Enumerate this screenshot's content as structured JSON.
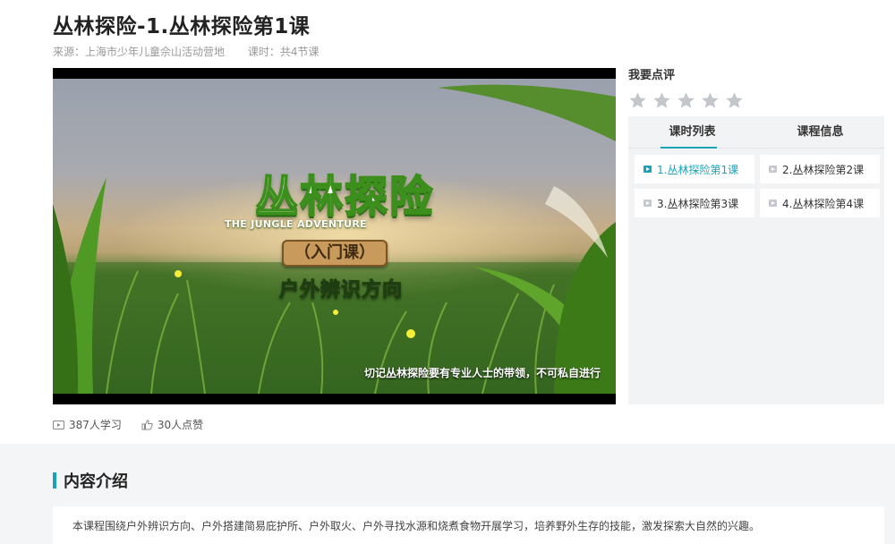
{
  "course": {
    "title": "丛林探险-1.丛林探险第1课",
    "source": "来源：上海市少年儿童佘山活动营地",
    "lessons_count": "课时：共4节课"
  },
  "video": {
    "logo_title": "丛林探险",
    "logo_en": "THE JUNGLE ADVENTURE",
    "plank": "（入门课）",
    "subtitle": "户外辨识方向",
    "caption": "切记丛林探险要有专业人士的带领，不可私自进行"
  },
  "rating": {
    "label": "我要点评",
    "stars_total": 5,
    "stars_filled": 0,
    "star_color": "#c3c7cc"
  },
  "tabs": [
    {
      "label": "课时列表",
      "active": true
    },
    {
      "label": "课程信息",
      "active": false
    }
  ],
  "lessons": [
    {
      "label": "1.丛林探险第1课",
      "active": true
    },
    {
      "label": "2.丛林探险第2课",
      "active": false
    },
    {
      "label": "3.丛林探险第3课",
      "active": false
    },
    {
      "label": "4.丛林探险第4课",
      "active": false
    }
  ],
  "stats": {
    "learners": "387人学习",
    "likes": "30人点赞"
  },
  "intro": {
    "heading": "内容介绍",
    "text": "本课程围绕户外辨识方向、户外搭建简易庇护所、户外取火、户外寻找水源和烧煮食物开展学习，培养野外生存的技能，激发探索大自然的兴趣。"
  },
  "colors": {
    "accent": "#1aa3b8"
  }
}
